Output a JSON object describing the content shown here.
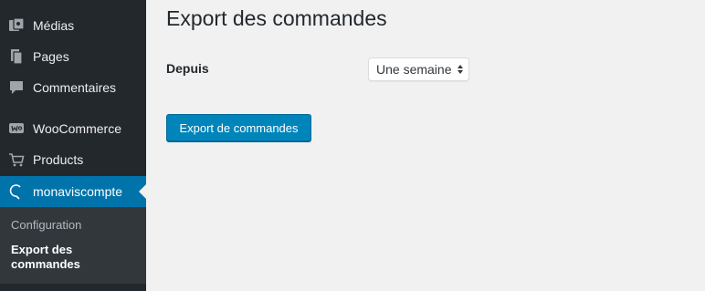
{
  "sidebar": {
    "items": [
      {
        "label": "Médias",
        "icon": "media-icon"
      },
      {
        "label": "Pages",
        "icon": "pages-icon"
      },
      {
        "label": "Commentaires",
        "icon": "comments-icon"
      },
      {
        "label": "WooCommerce",
        "icon": "woocommerce-icon"
      },
      {
        "label": "Products",
        "icon": "cart-icon"
      },
      {
        "label": "monaviscompte",
        "icon": "monaviscompte-icon"
      }
    ],
    "submenu": [
      {
        "label": "Configuration"
      },
      {
        "label": "Export des commandes"
      }
    ],
    "colors": {
      "background": "#23282d",
      "submenu_background": "#32373c",
      "current": "#0073aa"
    }
  },
  "main": {
    "title": "Export des commandes",
    "form": {
      "since_label": "Depuis",
      "since_value": "Une semaine",
      "export_button": "Export de commandes"
    },
    "colors": {
      "background": "#f1f1f1",
      "button": "#0085ba"
    }
  }
}
